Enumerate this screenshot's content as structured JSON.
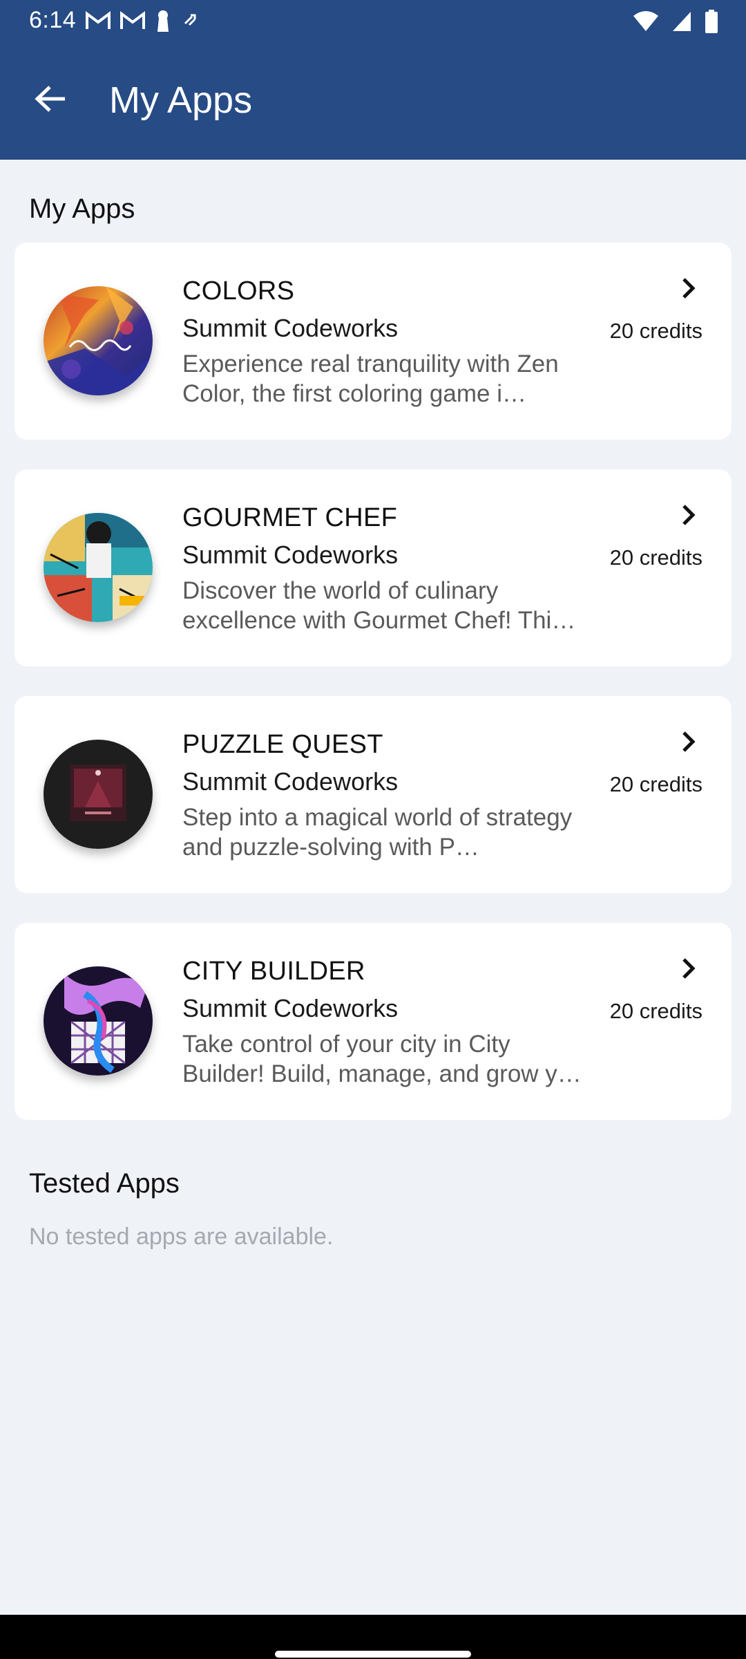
{
  "status_bar": {
    "time": "6:14",
    "left_icons": [
      "gmail-icon",
      "gmail-icon",
      "keyhole-icon",
      "sync-icon"
    ],
    "right_icons": [
      "wifi-icon",
      "signal-icon",
      "battery-icon"
    ]
  },
  "app_bar": {
    "title": "My Apps",
    "back_icon": "arrow-back-icon"
  },
  "my_apps": {
    "section_title": "My Apps",
    "items": [
      {
        "name": "COLORS",
        "developer": "Summit Codeworks",
        "description": "Experience real tranquility with Zen Color, the first coloring game i…",
        "credits": "20 credits"
      },
      {
        "name": "GOURMET CHEF",
        "developer": "Summit Codeworks",
        "description": "Discover the world of culinary excellence with Gourmet Chef! Thi…",
        "credits": "20 credits"
      },
      {
        "name": "PUZZLE QUEST",
        "developer": "Summit Codeworks",
        "description": "Step into a magical world of strategy and puzzle-solving with P…",
        "credits": "20 credits"
      },
      {
        "name": "CITY BUILDER",
        "developer": "Summit Codeworks",
        "description": "Take control of your city in City Builder! Build, manage, and grow y…",
        "credits": "20 credits"
      }
    ]
  },
  "tested_apps": {
    "section_title": "Tested Apps",
    "empty_message": "No tested apps are available."
  },
  "colors": {
    "header_bg": "#264b85",
    "page_bg": "#eff2f7",
    "card_bg": "#ffffff"
  }
}
